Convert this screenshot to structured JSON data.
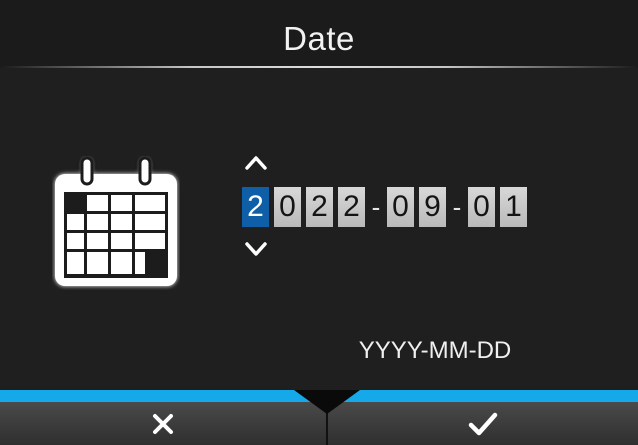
{
  "title": "Date",
  "date": {
    "digits": [
      "2",
      "0",
      "2",
      "2",
      "0",
      "9",
      "0",
      "1"
    ],
    "separator": "-",
    "selected_index": 0
  },
  "format_label": "YYYY-MM-DD",
  "footer": {
    "cancel_icon": "close-icon",
    "ok_icon": "check-icon"
  },
  "colors": {
    "accent": "#16a9ea",
    "selected_digit": "#0e5ea8"
  }
}
